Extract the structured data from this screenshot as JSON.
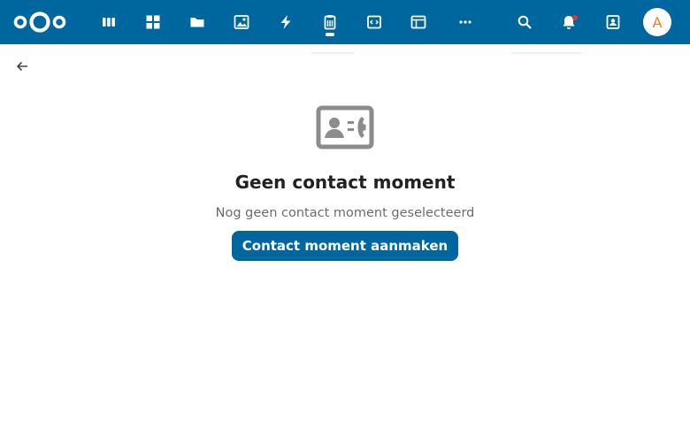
{
  "header": {
    "logo_icon": "nextcloud-logo",
    "apps": [
      {
        "icon": "dashboard-columns-icon"
      },
      {
        "icon": "apps-grid-icon"
      },
      {
        "icon": "folder-icon"
      },
      {
        "icon": "image-icon"
      },
      {
        "icon": "activity-lightning-icon"
      },
      {
        "icon": "clipboard-list-icon",
        "active": true
      },
      {
        "icon": "code-window-icon"
      },
      {
        "icon": "table-icon"
      },
      {
        "icon": "more-dots-icon"
      }
    ],
    "right": {
      "search_icon": "search-icon",
      "notifications_icon": "bell-icon",
      "contacts_icon": "contacts-icon",
      "avatar_initial": "A"
    },
    "colors": {
      "bar": "#00679e",
      "avatar_text": "#e67e22",
      "notification": "#e9322d"
    }
  },
  "back_icon": "arrow-left-icon",
  "empty_state": {
    "icon": "contact-card-icon",
    "title": "Geen contact moment",
    "description": "Nog geen contact moment geselecteerd",
    "button_label": "Contact moment aanmaken"
  },
  "colors": {
    "primary": "#00679e",
    "text": "#222222",
    "muted": "#6b6b6b",
    "icon_gray": "#8c8c8c"
  }
}
